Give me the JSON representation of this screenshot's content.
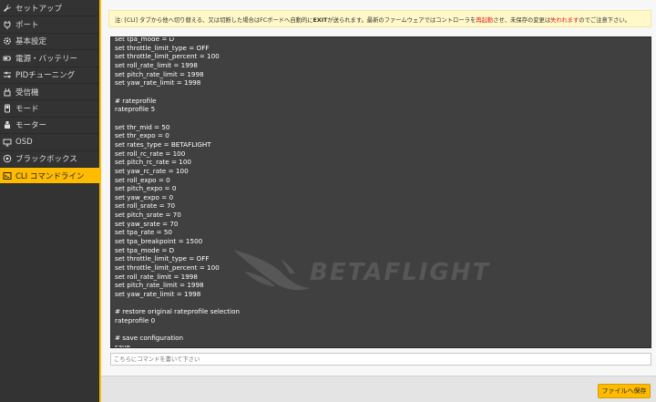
{
  "sidebar": {
    "items": [
      {
        "label": "セットアップ",
        "icon": "wrench-icon"
      },
      {
        "label": "ポート",
        "icon": "plug-icon"
      },
      {
        "label": "基本設定",
        "icon": "gear-icon"
      },
      {
        "label": "電源・バッテリー",
        "icon": "battery-icon"
      },
      {
        "label": "PIDチューニング",
        "icon": "sliders-icon"
      },
      {
        "label": "受信機",
        "icon": "receiver-icon"
      },
      {
        "label": "モード",
        "icon": "switch-icon"
      },
      {
        "label": "モーター",
        "icon": "motor-icon"
      },
      {
        "label": "OSD",
        "icon": "monitor-icon"
      },
      {
        "label": "ブラックボックス",
        "icon": "blackbox-icon"
      },
      {
        "label": "CLI コマンドライン",
        "icon": "terminal-icon",
        "active": true
      }
    ]
  },
  "notice": {
    "part1": "注: [CLI] タブから他へ切り替える、又は切断した場合はFCボードへ自動的に",
    "exit": "EXIT",
    "part2": "が送られます。最新のファームウェアではコントローラを",
    "restart": "再起動",
    "part3": "させ、未保存の変更は",
    "lost": "失われます",
    "part4": "のでご注意下さい。"
  },
  "console": {
    "lines": [
      "set tpa_mode = D",
      "set throttle_limit_type = OFF",
      "set throttle_limit_percent = 100",
      "set roll_rate_limit = 1998",
      "set pitch_rate_limit = 1998",
      "set yaw_rate_limit = 1998",
      "",
      "# rateprofile",
      "rateprofile 5",
      "",
      "set thr_mid = 50",
      "set thr_expo = 0",
      "set rates_type = BETAFLIGHT",
      "set roll_rc_rate = 100",
      "set pitch_rc_rate = 100",
      "set yaw_rc_rate = 100",
      "set roll_expo = 0",
      "set pitch_expo = 0",
      "set yaw_expo = 0",
      "set roll_srate = 70",
      "set pitch_srate = 70",
      "set yaw_srate = 70",
      "set tpa_rate = 50",
      "set tpa_breakpoint = 1500",
      "set tpa_mode = D",
      "set throttle_limit_type = OFF",
      "set throttle_limit_percent = 100",
      "set roll_rate_limit = 1998",
      "set pitch_rate_limit = 1998",
      "set yaw_rate_limit = 1998",
      "",
      "# restore original rateprofile selection",
      "rateprofile 0",
      "",
      "# save configuration",
      "save"
    ],
    "watermark": "BETAFLIGHT"
  },
  "command_input": {
    "placeholder": "こちらにコマンドを書いて下さい",
    "value": ""
  },
  "footer": {
    "save_label": "ファイルへ保存"
  },
  "colors": {
    "accent": "#ffbb00",
    "sidebar_bg": "#333333",
    "console_bg": "#404040",
    "warning": "#e02020"
  }
}
